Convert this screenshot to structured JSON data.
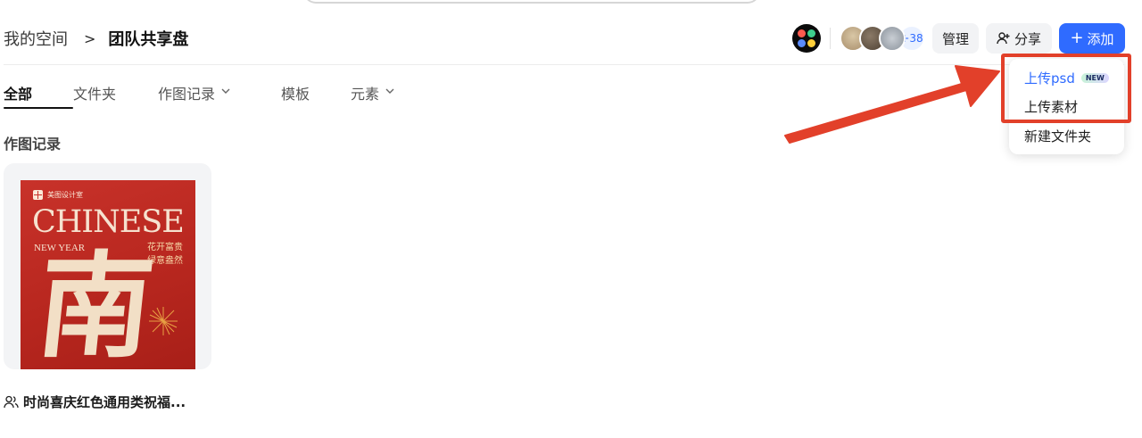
{
  "breadcrumb": {
    "parent": "我的空间",
    "separator": ">",
    "current": "团队共享盘"
  },
  "header": {
    "member_more": "+38",
    "manage_label": "管理",
    "share_label": "分享",
    "add_label": "添加",
    "add_plus": "+"
  },
  "tabs": [
    {
      "label": "全部",
      "active": true
    },
    {
      "label": "文件夹"
    },
    {
      "label": "作图记录",
      "has_dropdown": true
    },
    {
      "label": "模板"
    },
    {
      "label": "元素",
      "has_dropdown": true
    }
  ],
  "section": {
    "title": "作图记录"
  },
  "card": {
    "title": "时尚喜庆红色通用类祝福...",
    "poster": {
      "brand": "美图设计室",
      "headline": "CHINESE",
      "subline": "NEW YEAR",
      "cn_line1": "花开富贵",
      "cn_line2": "绿意盎然",
      "big_char": "南"
    }
  },
  "dropdown": {
    "items": [
      {
        "label": "上传psd",
        "badge": "NEW",
        "highlighted": true
      },
      {
        "label": "上传素材"
      },
      {
        "label": "新建文件夹"
      }
    ]
  },
  "colors": {
    "accent": "#2f6bff",
    "annotation": "#e2402a"
  },
  "icons": [
    "team-logo-icon",
    "chevron-right-icon",
    "add-person-icon",
    "plus-icon",
    "chevron-down-icon",
    "team-icon"
  ]
}
